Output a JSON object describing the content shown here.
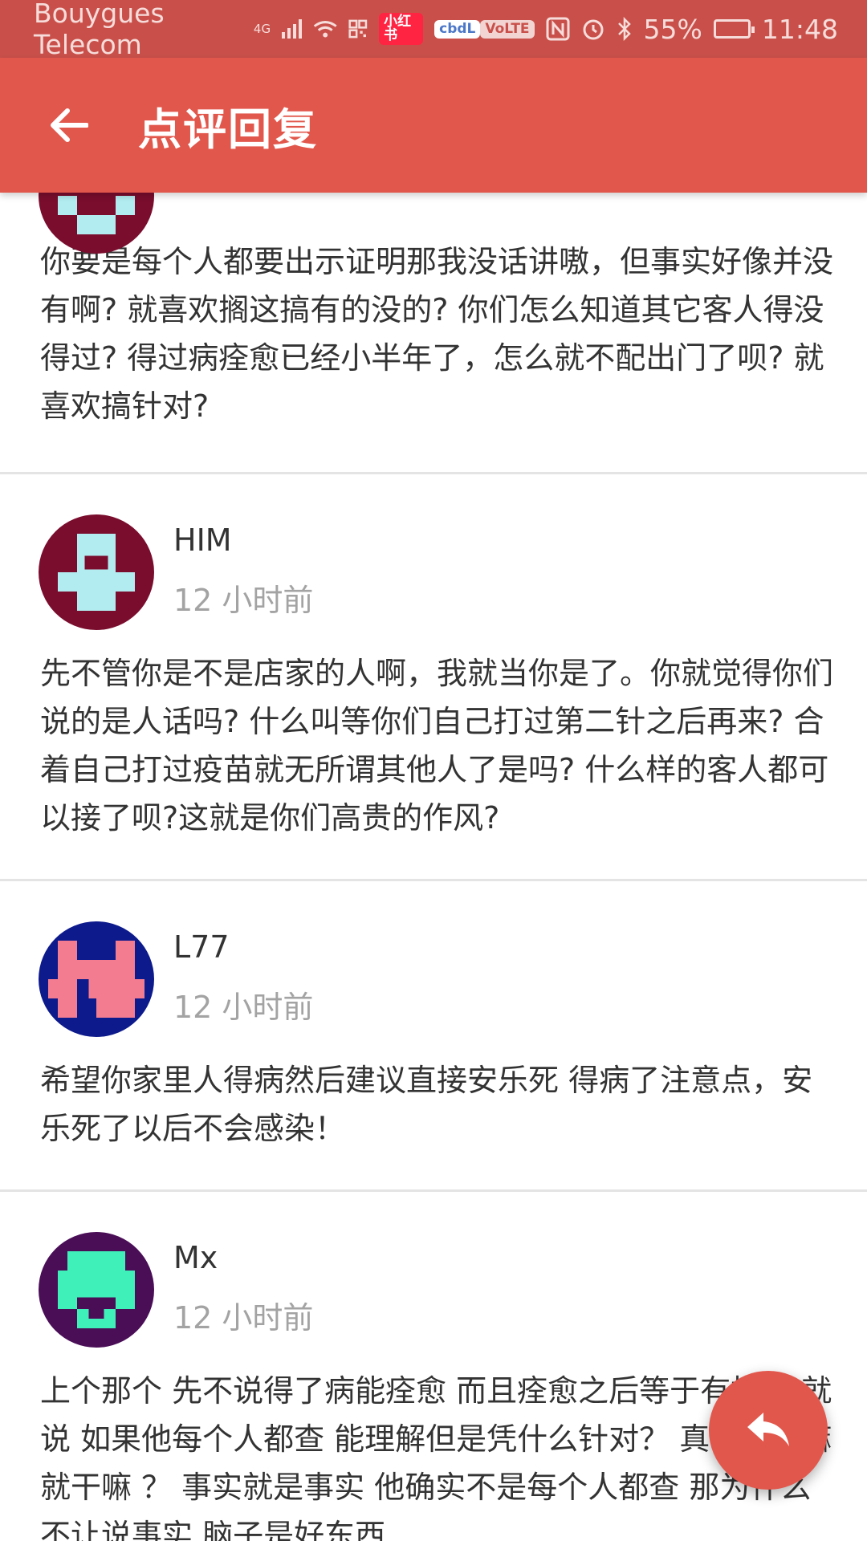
{
  "status_bar": {
    "carrier": "Bouygues Telecom",
    "network": "4G",
    "app_badges": [
      "小红书",
      "cbdL"
    ],
    "volte": "VoLTE",
    "battery": "55%",
    "battery_level": 0.55,
    "time": "11:48"
  },
  "header": {
    "title": "点评回复",
    "back_icon": "arrow-left-icon"
  },
  "reviews": [
    {
      "username": "",
      "time": "",
      "avatar_colors": {
        "bg": "#7a0d2e",
        "fg": "#b3ecf0"
      },
      "text": "你要是每个人都要出示证明那我没话讲嗷，但事实好像并没有啊? 就喜欢搁这搞有的没的? 你们怎么知道其它客人得没得过? 得过病痊愈已经小半年了，怎么就不配出门了呗? 就喜欢搞针对?"
    },
    {
      "username": "HIM",
      "time": "12 小时前",
      "avatar_colors": {
        "bg": "#7a0d2e",
        "fg": "#b3ecf0"
      },
      "text": "先不管你是不是店家的人啊，我就当你是了。你就觉得你们说的是人话吗? 什么叫等你们自己打过第二针之后再来? 合着自己打过疫苗就无所谓其他人了是吗? 什么样的客人都可以接了呗?这就是你们高贵的作风?"
    },
    {
      "username": "L77",
      "time": "12 小时前",
      "avatar_colors": {
        "bg": "#0d1a8c",
        "fg": "#f47c91"
      },
      "text": "希望你家里人得病然后建议直接安乐死 得病了注意点，安乐死了以后不会感染！"
    },
    {
      "username": "Mx",
      "time": "12 小时前",
      "avatar_colors": {
        "bg": "#4a0e57",
        "fg": "#3ff0b8"
      },
      "text": "上个那个 先不说得了病能痊愈 而且痊愈之后等于有抗体 就说 如果他每个人都查 能理解但是凭什么针对？ 真当想干嘛就干嘛 ？ 事实就是事实 他确实不是每个人都查 那为什么不让说事实 脑子是好东西"
    }
  ],
  "fab": {
    "icon": "reply-icon"
  }
}
